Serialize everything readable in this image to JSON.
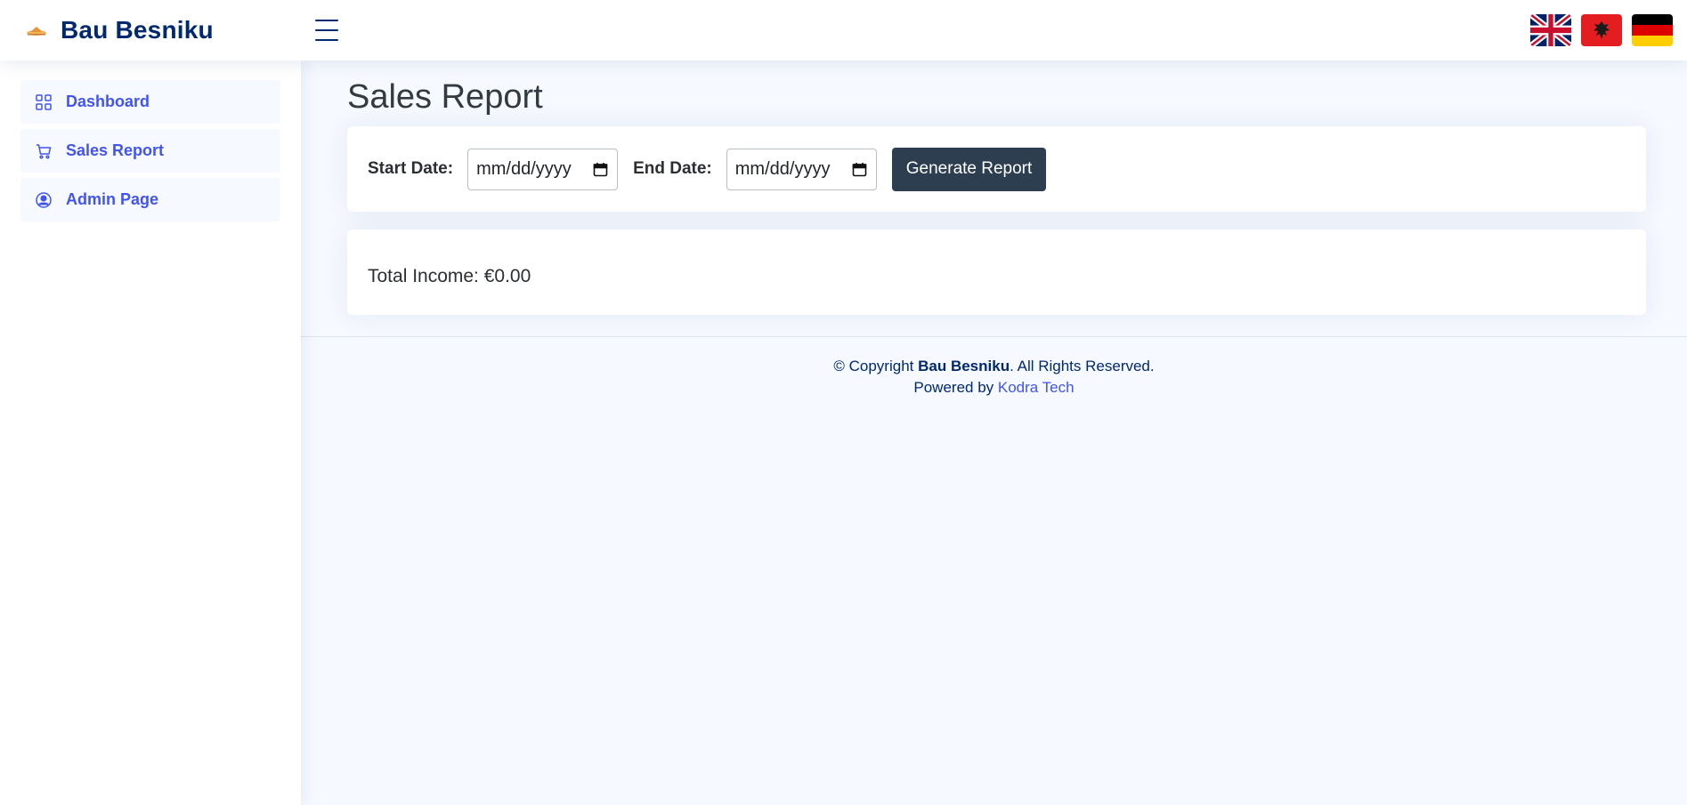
{
  "header": {
    "brand": "Bau Besniku",
    "menu_toggle_icon": "hamburger-icon",
    "flags": [
      {
        "name": "uk-flag-icon"
      },
      {
        "name": "albania-flag-icon"
      },
      {
        "name": "germany-flag-icon"
      }
    ]
  },
  "sidebar": {
    "items": [
      {
        "label": "Dashboard",
        "icon": "grid-icon"
      },
      {
        "label": "Sales Report",
        "icon": "cart-icon"
      },
      {
        "label": "Admin Page",
        "icon": "person-circle-icon"
      }
    ]
  },
  "main": {
    "title": "Sales Report",
    "filters": {
      "start_label": "Start Date:",
      "start_placeholder": "mm/dd/yyyy",
      "end_label": "End Date:",
      "end_placeholder": "mm/dd/yyyy",
      "generate_label": "Generate Report"
    },
    "total_income": "Total Income: €0.00"
  },
  "footer": {
    "copyright_prefix": "© Copyright ",
    "company": "Bau Besniku",
    "rights": ". All Rights Reserved.",
    "powered_by": "Powered by ",
    "powered_link": "Kodra Tech"
  },
  "colors": {
    "brand": "#012970",
    "accent": "#4154f1",
    "button": "#2c3e50",
    "background": "#f6f9ff"
  }
}
